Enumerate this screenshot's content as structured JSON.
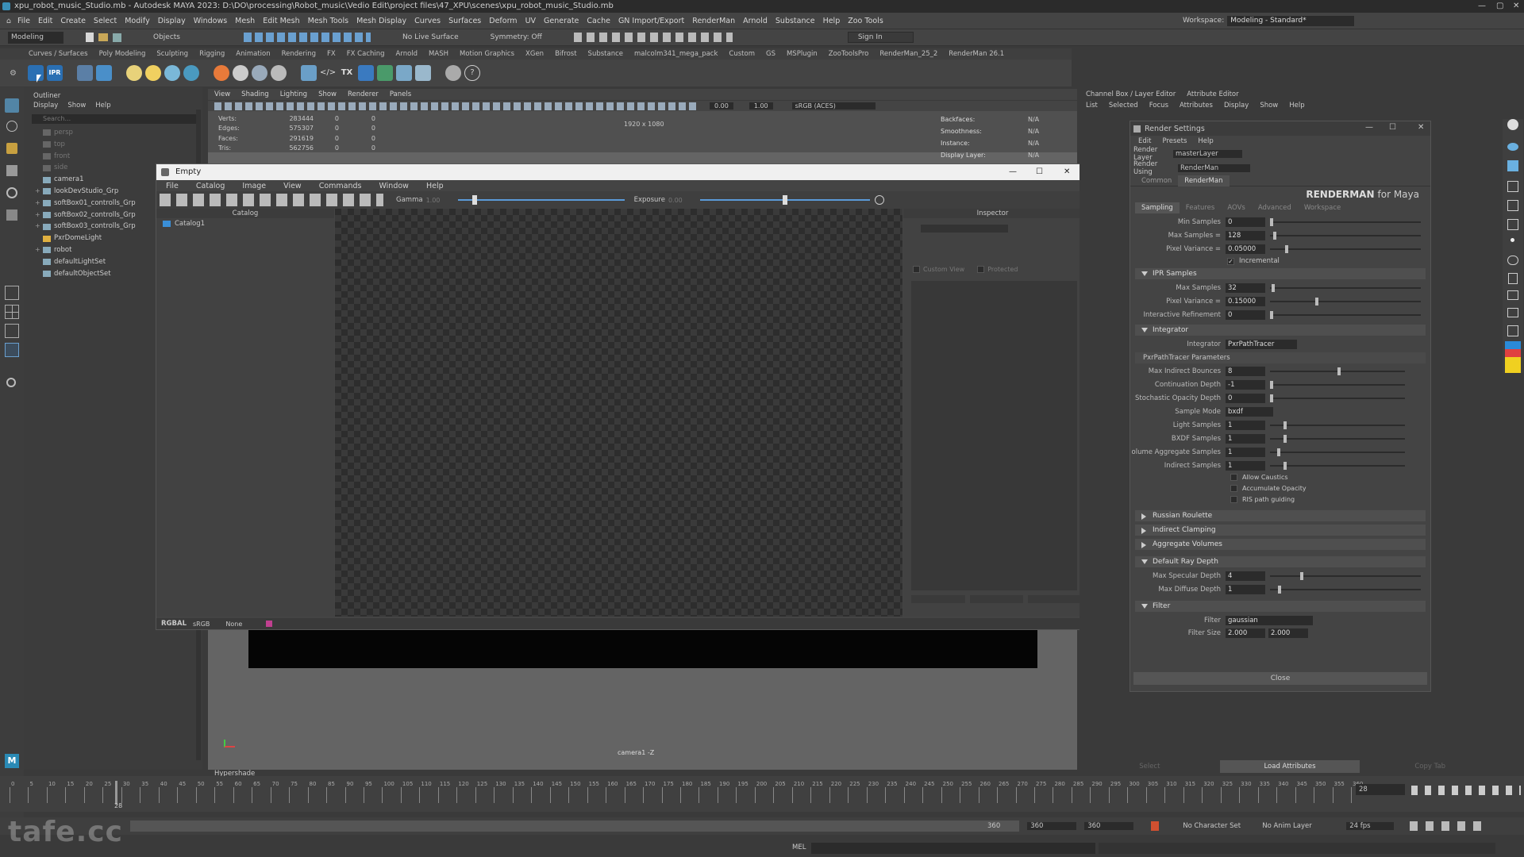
{
  "app": {
    "title": "xpu_robot_music_Studio.mb - Autodesk MAYA 2023: D:\\DO\\processing\\Robot_music\\Vedio Edit\\project files\\47_XPU\\scenes\\xpu_robot_music_Studio.mb",
    "menus": [
      "File",
      "Edit",
      "Create",
      "Select",
      "Modify",
      "Display",
      "Windows",
      "Mesh",
      "Edit Mesh",
      "Mesh Tools",
      "Mesh Display",
      "Curves",
      "Surfaces",
      "Deform",
      "UV",
      "Generate",
      "Cache",
      "GN Import/Export",
      "RenderMan",
      "Arnold",
      "Substance",
      "Help",
      "Zoo Tools"
    ],
    "workspace_label": "Workspace:",
    "workspace_value": "Modeling - Standard*",
    "mode_value": "Modeling",
    "objects_label": "Objects",
    "no_live_surface": "No Live Surface",
    "symmetry": "Symmetry: Off",
    "sign_in": "Sign In"
  },
  "shelf": {
    "tabs": [
      "Curves / Surfaces",
      "Poly Modeling",
      "Sculpting",
      "Rigging",
      "Animation",
      "Rendering",
      "FX",
      "FX Caching",
      "Arnold",
      "MASH",
      "Motion Graphics",
      "XGen",
      "Bifrost",
      "Substance",
      "malcolm341_mega_pack",
      "Custom",
      "GS",
      "MSPlugin",
      "ZooToolsPro",
      "RenderMan_25_2",
      "RenderMan 26.1"
    ],
    "ipr_label": "IPR"
  },
  "outliner": {
    "title": "Outliner",
    "menus": [
      "Display",
      "Show",
      "Help"
    ],
    "search_placeholder": "Search...",
    "items": [
      "persp",
      "top",
      "front",
      "side",
      "camera1",
      "lookDevStudio_Grp",
      "softBox01_controlls_Grp",
      "softBox02_controlls_Grp",
      "softBox03_controlls_Grp",
      "PxrDomeLight",
      "robot",
      "defaultLightSet",
      "defaultObjectSet"
    ]
  },
  "viewport": {
    "menus": [
      "View",
      "Shading",
      "Lighting",
      "Show",
      "Renderer",
      "Panels"
    ],
    "hud_left": [
      {
        "label": "Verts:",
        "v1": "283444",
        "v2": "0",
        "v3": "0"
      },
      {
        "label": "Edges:",
        "v1": "575307",
        "v2": "0",
        "v3": "0"
      },
      {
        "label": "Faces:",
        "v1": "291619",
        "v2": "0",
        "v3": "0"
      },
      {
        "label": "Tris:",
        "v1": "562756",
        "v2": "0",
        "v3": "0"
      }
    ],
    "hud_right": [
      {
        "label": "Backfaces:",
        "value": "N/A"
      },
      {
        "label": "Smoothness:",
        "value": "N/A"
      },
      {
        "label": "Instance:",
        "value": "N/A"
      },
      {
        "label": "Display Layer:",
        "value": "N/A"
      }
    ],
    "resolution": "1920 x 1080",
    "camera_label": "camera1 -Z",
    "exposure_value": "0.00",
    "gamma_value": "1.00",
    "colorspace": "sRGB (ACES)",
    "hypershade_label": "Hypershade"
  },
  "it_window": {
    "title": "Empty",
    "menus": [
      "File",
      "Catalog",
      "Image",
      "View",
      "Commands",
      "Window",
      "Help"
    ],
    "gamma_label": "Gamma",
    "gamma_value": "1.00",
    "exposure_label": "Exposure",
    "exposure_value": "0.00",
    "catalog_header": "Catalog",
    "catalog_item": "Catalog1",
    "inspector_header": "Inspector",
    "custom_view": "Custom View",
    "protected": "Protected",
    "channel": "RGBAL",
    "colorspace": "sRGB",
    "lut": "None"
  },
  "channelbox": {
    "tabs": [
      "Channel Box / Layer Editor",
      "Attribute Editor"
    ],
    "menus": [
      "List",
      "Selected",
      "Focus",
      "Attributes",
      "Display",
      "Show",
      "Help"
    ],
    "bottom_buttons": [
      "Select",
      "Load Attributes",
      "Copy Tab"
    ]
  },
  "render_settings": {
    "title": "Render Settings",
    "menus": [
      "Edit",
      "Presets",
      "Help"
    ],
    "render_layer_label": "Render Layer",
    "render_layer_value": "masterLayer",
    "render_using_label": "Render Using",
    "render_using_value": "RenderMan",
    "tabs": [
      "Common",
      "RenderMan"
    ],
    "logo": "RENDERMAN",
    "logo_suffix": "for Maya",
    "subtabs": [
      "Sampling",
      "Features",
      "AOVs",
      "Advanced",
      "Workspace"
    ],
    "sampling": [
      {
        "label": "Min Samples",
        "value": "0",
        "pos": 0.0
      },
      {
        "label": "Max Samples =",
        "value": "128",
        "pos": 0.02
      },
      {
        "label": "Pixel Variance =",
        "value": "0.05000",
        "pos": 0.1
      }
    ],
    "incremental_label": "Incremental",
    "ipr_section": "IPR Samples",
    "ipr": [
      {
        "label": "Max Samples",
        "value": "32",
        "pos": 0.01
      },
      {
        "label": "Pixel Variance =",
        "value": "0.15000",
        "pos": 0.3
      },
      {
        "label": "Interactive Refinement",
        "value": "0",
        "pos": 0.0
      }
    ],
    "integrator_section": "Integrator",
    "integrator_label": "Integrator",
    "integrator_value": "PxrPathTracer",
    "pxr_section": "PxrPathTracer Parameters",
    "pxr": [
      {
        "label": "Max Indirect Bounces",
        "value": "8",
        "pos": 0.5
      },
      {
        "label": "Continuation Depth",
        "value": "-1",
        "pos": 0.0
      },
      {
        "label": "Stochastic Opacity Depth",
        "value": "0",
        "pos": 0.0
      },
      {
        "label": "Sample Mode",
        "value": "bxdf",
        "select": true
      },
      {
        "label": "Light Samples",
        "value": "1",
        "pos": 0.1
      },
      {
        "label": "BXDF Samples",
        "value": "1",
        "pos": 0.1
      },
      {
        "label": "olume Aggregate Samples",
        "value": "1",
        "pos": 0.05
      },
      {
        "label": "Indirect Samples",
        "value": "1",
        "pos": 0.1
      }
    ],
    "checkboxes": [
      "Allow Caustics",
      "Accumulate Opacity",
      "RIS path guiding"
    ],
    "collapsed": [
      "Russian Roulette",
      "Indirect Clamping",
      "Aggregate Volumes"
    ],
    "ray_section": "Default Ray Depth",
    "ray": [
      {
        "label": "Max Specular Depth",
        "value": "4",
        "pos": 0.2
      },
      {
        "label": "Max Diffuse Depth",
        "value": "1",
        "pos": 0.05
      }
    ],
    "filter_section": "Filter",
    "filter_label": "Filter",
    "filter_value": "gaussian",
    "filter_size_label": "Filter Size",
    "filter_size_1": "2.000",
    "filter_size_2": "2.000",
    "close": "Close"
  },
  "timeline": {
    "ticks": [
      "0",
      "5",
      "10",
      "15",
      "20",
      "25",
      "30",
      "35",
      "40",
      "45",
      "50",
      "55",
      "60",
      "65",
      "70",
      "75",
      "80",
      "85",
      "90",
      "95",
      "100",
      "105",
      "110",
      "115",
      "120",
      "125",
      "130",
      "135",
      "140",
      "145",
      "150",
      "155",
      "160",
      "165",
      "170",
      "175",
      "180",
      "185",
      "190",
      "195",
      "200",
      "205",
      "210",
      "215",
      "220",
      "225",
      "230",
      "235",
      "240",
      "245",
      "250",
      "255",
      "260",
      "265",
      "270",
      "275",
      "280",
      "285",
      "290",
      "295",
      "300",
      "305",
      "310",
      "315",
      "320",
      "325",
      "330",
      "335",
      "340",
      "345",
      "350",
      "355",
      "360"
    ],
    "current_frame": "28",
    "current_frame_field": "28",
    "range_end_1": "360",
    "range_end_2": "360",
    "range_end_3": "360",
    "no_character_set": "No Character Set",
    "no_anim_layer": "No Anim Layer",
    "fps": "24 fps",
    "mel": "MEL",
    "watermark": "tafe.cc"
  }
}
